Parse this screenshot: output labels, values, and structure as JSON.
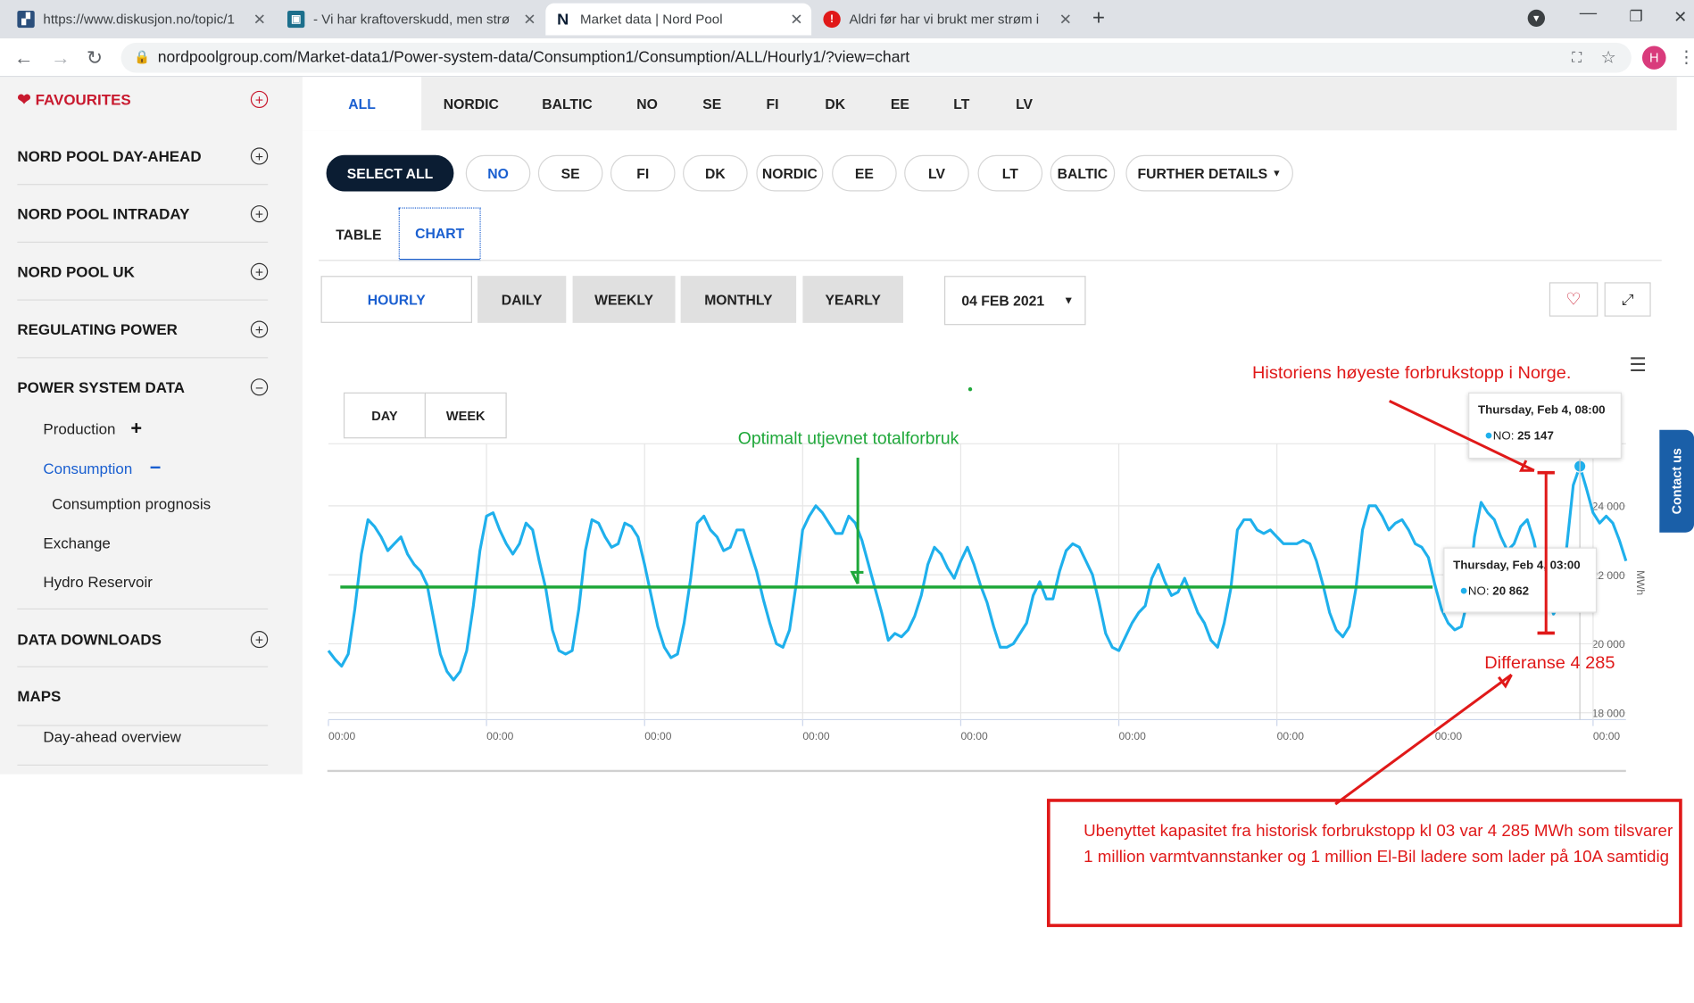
{
  "browser": {
    "tabs": [
      {
        "favicon": "diskusjon-icon",
        "title": "https://www.diskusjon.no/topic/1",
        "active": false
      },
      {
        "favicon": "news-icon",
        "title": "- Vi har kraftoverskudd, men strø",
        "active": false
      },
      {
        "favicon": "N",
        "title": "Market data | Nord Pool",
        "active": true
      },
      {
        "favicon": "alert-icon",
        "title": "Aldri før har vi brukt mer strøm i",
        "active": false
      }
    ],
    "url": "nordpoolgroup.com/Market-data1/Power-system-data/Consumption1/Consumption/ALL/Hourly1/?view=chart",
    "profile_initial": "H",
    "colors": {
      "tabbar": "#dee1e6",
      "profile": "#d93b7c"
    }
  },
  "sidebar": {
    "favourites": "FAVOURITES",
    "sections": [
      {
        "label": "NORD POOL DAY-AHEAD",
        "expanded": false
      },
      {
        "label": "NORD POOL INTRADAY",
        "expanded": false
      },
      {
        "label": "NORD POOL UK",
        "expanded": false
      },
      {
        "label": "REGULATING POWER",
        "expanded": false
      },
      {
        "label": "POWER SYSTEM DATA",
        "expanded": true
      },
      {
        "label": "DATA DOWNLOADS",
        "expanded": false
      },
      {
        "label": "MAPS",
        "expanded": false
      }
    ],
    "power_system_items": [
      "Production",
      "Consumption",
      "Consumption prognosis",
      "Exchange",
      "Hydro Reservoir"
    ],
    "maps_items": [
      "Day-ahead overview"
    ]
  },
  "main": {
    "region_tabs": [
      "ALL",
      "NORDIC",
      "BALTIC",
      "NO",
      "SE",
      "FI",
      "DK",
      "EE",
      "LT",
      "LV"
    ],
    "filters": [
      "SELECT ALL",
      "NO",
      "SE",
      "FI",
      "DK",
      "NORDIC",
      "EE",
      "LV",
      "LT",
      "BALTIC",
      "FURTHER DETAILS"
    ],
    "view_tabs": [
      "TABLE",
      "CHART"
    ],
    "resolutions": [
      "HOURLY",
      "DAILY",
      "WEEKLY",
      "MONTHLY",
      "YEARLY"
    ],
    "date": "04 FEB 2021",
    "contact": "Contact us",
    "accent": "#1a5fd0"
  },
  "chart_data": {
    "type": "line",
    "range_buttons": [
      "DAY",
      "WEEK"
    ],
    "ylabel": "MWh",
    "yticks": [
      "18 000",
      "20 000",
      "22 000",
      "24 000"
    ],
    "yticks_values": [
      18000,
      20000,
      22000,
      24000
    ],
    "ylim": [
      17800,
      25800
    ],
    "xtick_label": "00:00",
    "grid": true,
    "series": [
      {
        "name": "NO",
        "color": "#1fb0ec",
        "values": [
          19800,
          19550,
          19350,
          19700,
          21000,
          22600,
          23600,
          23400,
          23100,
          22700,
          22900,
          23100,
          22600,
          22300,
          22100,
          21700,
          20700,
          19700,
          19200,
          18950,
          19200,
          19800,
          21100,
          22700,
          23700,
          23800,
          23300,
          22900,
          22600,
          22900,
          23500,
          23300,
          22400,
          21600,
          20400,
          19800,
          19700,
          19800,
          21000,
          22700,
          23600,
          23500,
          23100,
          22800,
          22900,
          23500,
          23400,
          23100,
          22300,
          21400,
          20500,
          19900,
          19600,
          19700,
          20600,
          21900,
          23500,
          23700,
          23300,
          23100,
          22700,
          22800,
          23300,
          23300,
          22700,
          22100,
          21300,
          20600,
          20000,
          19900,
          20400,
          21700,
          23300,
          23700,
          24000,
          23800,
          23500,
          23200,
          23200,
          23700,
          23500,
          23000,
          22300,
          21600,
          20900,
          20100,
          20300,
          20200,
          20400,
          20800,
          21400,
          22300,
          22800,
          22600,
          22200,
          21900,
          22400,
          22800,
          22300,
          21700,
          21200,
          20500,
          19900,
          19900,
          20000,
          20300,
          20600,
          21400,
          21800,
          21300,
          21300,
          22100,
          22700,
          22900,
          22800,
          22400,
          22000,
          21200,
          20300,
          19900,
          19800,
          20200,
          20600,
          20900,
          21100,
          21900,
          22300,
          21800,
          21400,
          21500,
          21900,
          21400,
          20900,
          20600,
          20100,
          19900,
          20600,
          21600,
          23300,
          23600,
          23600,
          23300,
          23200,
          23300,
          23100,
          22900,
          22900,
          22900,
          23000,
          22900,
          22400,
          21700,
          20900,
          20400,
          20200,
          20500,
          21600,
          23300,
          24000,
          24000,
          23700,
          23300,
          23500,
          23600,
          23300,
          22900,
          22800,
          22500,
          21700,
          21000,
          20600,
          20400,
          20500,
          21300,
          23100,
          24100,
          23800,
          23600,
          23100,
          22700,
          22900,
          23400,
          23600,
          23000,
          22100,
          21400,
          20862,
          21200,
          22800,
          24600,
          25147,
          24500,
          23800,
          23500,
          23700,
          23500,
          23000,
          22400
        ]
      }
    ],
    "tooltips": [
      {
        "title": "Thursday, Feb 4, 08:00",
        "series": "NO:",
        "value": "25 147"
      },
      {
        "title": "Thursday, Feb 4, 03:00",
        "series": "NO:",
        "value": "20 862"
      }
    ],
    "annotations": {
      "record": "Historiens høyeste forbrukstopp i Norge.",
      "optimal": "Optimalt utjevnet totalforbruk",
      "difference": "Differanse 4 285",
      "note": "Ubenyttet kapasitet fra historisk forbrukstopp kl 03 var 4 285 MWh som tilsvarer 1 million varmtvannstanker og 1 million El-Bil ladere som lader på 10A samtidig",
      "colors": {
        "red": "#e01919",
        "green": "#1fa83a"
      }
    }
  }
}
